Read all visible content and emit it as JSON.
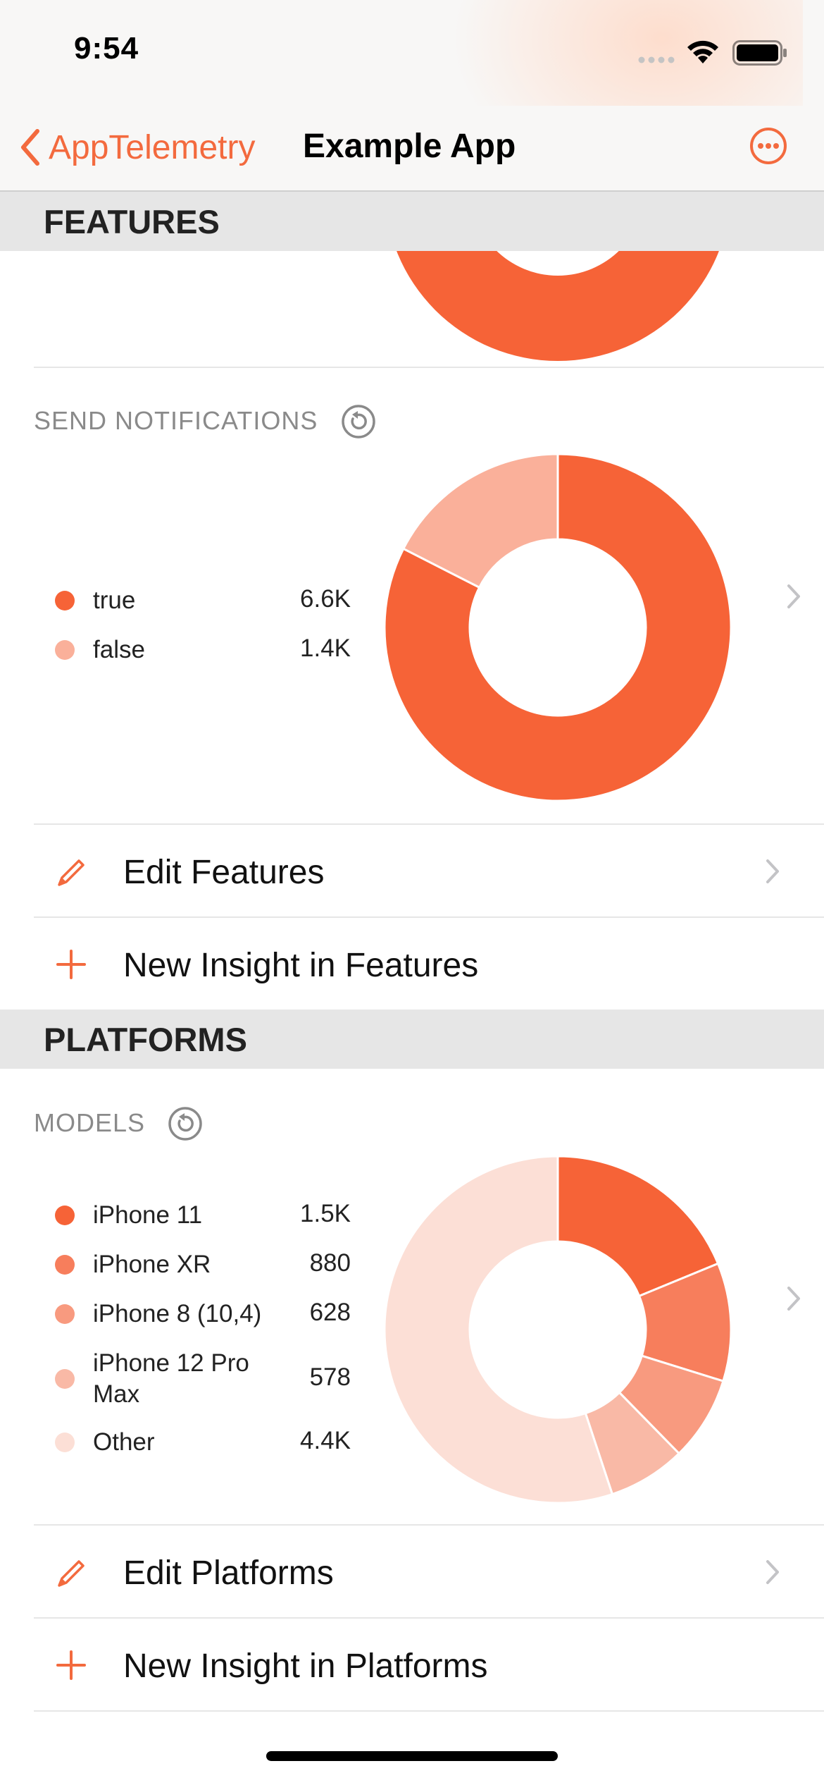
{
  "status_bar": {
    "time": "9:54"
  },
  "nav": {
    "back_label": "AppTelemetry",
    "title": "Example App",
    "more_icon": "ellipsis-circle-icon"
  },
  "colors": {
    "accent": "#f36a3e"
  },
  "features": {
    "header": "FEATURES",
    "send_notifications": {
      "title": "SEND NOTIFICATIONS",
      "legend": [
        {
          "label": "true",
          "value": "6.6K",
          "color": "#f66337"
        },
        {
          "label": "false",
          "value": "1.4K",
          "color": "#fab09a"
        }
      ]
    },
    "edit_label": "Edit Features",
    "new_label": "New Insight in Features"
  },
  "platforms": {
    "header": "PLATFORMS",
    "models": {
      "title": "MODELS",
      "legend": [
        {
          "label": "iPhone 11",
          "value": "1.5K",
          "color": "#f66337"
        },
        {
          "label": "iPhone XR",
          "value": "880",
          "color": "#f77e5c"
        },
        {
          "label": "iPhone 8 (10,4)",
          "value": "628",
          "color": "#f89a7f"
        },
        {
          "label": "iPhone 12 Pro Max",
          "value": "578",
          "color": "#f9b9a6"
        },
        {
          "label": "Other",
          "value": "4.4K",
          "color": "#fcdfd6"
        }
      ]
    },
    "edit_label": "Edit Platforms",
    "new_label": "New Insight in Platforms"
  },
  "chart_data": [
    {
      "type": "pie",
      "title": "SEND NOTIFICATIONS",
      "categories": [
        "true",
        "false"
      ],
      "values": [
        6600,
        1400
      ]
    },
    {
      "type": "pie",
      "title": "MODELS",
      "categories": [
        "iPhone 11",
        "iPhone XR",
        "iPhone 8 (10,4)",
        "iPhone 12 Pro Max",
        "Other"
      ],
      "values": [
        1500,
        880,
        628,
        578,
        4400
      ]
    }
  ]
}
